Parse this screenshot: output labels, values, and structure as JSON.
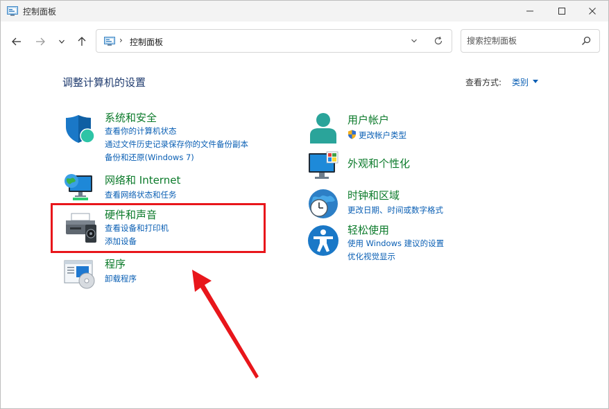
{
  "window": {
    "title": "控制面板"
  },
  "navbar": {
    "address_sep": "›",
    "address_text": "控制面板",
    "search_placeholder": "搜索控制面板"
  },
  "main": {
    "heading": "调整计算机的设置",
    "view_by_label": "查看方式:",
    "view_by_value": "类别"
  },
  "categories": {
    "system": {
      "title": "系统和安全",
      "links": [
        "查看你的计算机状态",
        "通过文件历史记录保存你的文件备份副本",
        "备份和还原(Windows 7)"
      ]
    },
    "network": {
      "title": "网络和 Internet",
      "links": [
        "查看网络状态和任务"
      ]
    },
    "hardware": {
      "title": "硬件和声音",
      "links": [
        "查看设备和打印机",
        "添加设备"
      ]
    },
    "programs": {
      "title": "程序",
      "links": [
        "卸载程序"
      ]
    },
    "accounts": {
      "title": "用户帐户",
      "links": [
        "更改帐户类型"
      ]
    },
    "appearance": {
      "title": "外观和个性化",
      "links": []
    },
    "clock": {
      "title": "时钟和区域",
      "links": [
        "更改日期、时间或数字格式"
      ]
    },
    "ease": {
      "title": "轻松使用",
      "links": [
        "使用 Windows 建议的设置",
        "优化视觉显示"
      ]
    }
  },
  "colors": {
    "category_title": "#0b7a2a",
    "link": "#0a5fb4",
    "heading": "#1e3a6e",
    "annotation_red": "#e8161b"
  }
}
